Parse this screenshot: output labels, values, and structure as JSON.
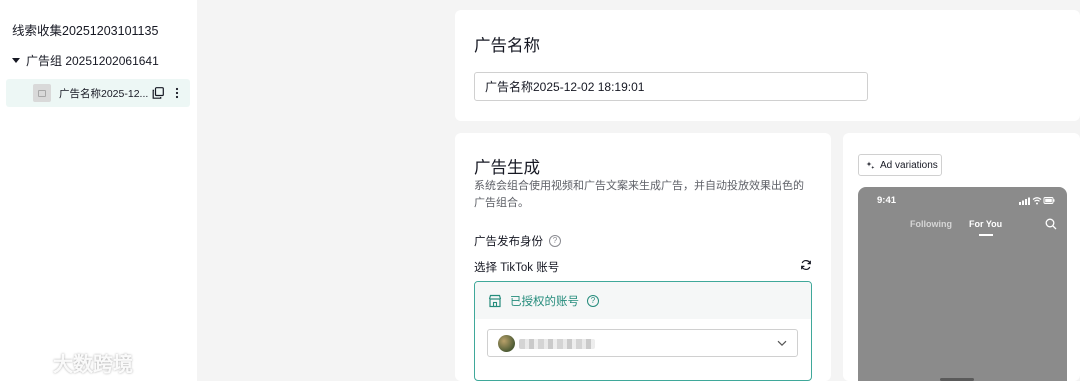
{
  "sidebar": {
    "campaign_title": "线索收集20251203101135",
    "ad_group_label": "广告组 20251202061641",
    "ad_item_label": "广告名称2025-12..."
  },
  "ad_name_section": {
    "title": "广告名称",
    "input_value": "广告名称2025-12-02 18:19:01"
  },
  "ad_generation_section": {
    "title": "广告生成",
    "description": "系统会组合使用视频和广告文案来生成广告，并自动投放效果出色的广告组合。",
    "identity_label": "广告发布身份",
    "select_tiktok_label": "选择 TikTok 账号",
    "authorized_accounts_label": "已授权的账号"
  },
  "preview": {
    "ad_variations_label": "Ad variations",
    "phone_time": "9:41",
    "tab_following": "Following",
    "tab_for_you": "For You"
  },
  "watermark": {
    "text": "大数跨境"
  },
  "colors": {
    "accent": "#258c7c",
    "accent_border": "#3fa89a",
    "selected_row_bg": "#edf7f5",
    "page_bg": "#f4f4f4"
  }
}
